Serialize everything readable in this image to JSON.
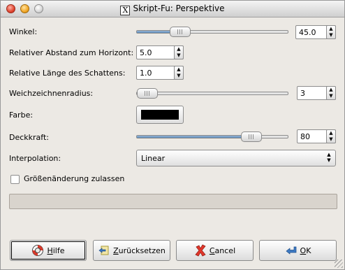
{
  "window": {
    "title": "Skript-Fu: Perspektive",
    "x_icon_glyph": "X"
  },
  "fields": {
    "angle": {
      "label": "Winkel:",
      "value": "45.0",
      "slider_fraction": 0.25
    },
    "horizon_distance": {
      "label": "Relativer Abstand zum Horizont:",
      "value": "5.0"
    },
    "shadow_length": {
      "label": "Relative Länge des Schattens:",
      "value": "1.0"
    },
    "blur_radius": {
      "label": "Weichzeichnenradius:",
      "value": "3",
      "slider_fraction": 0.0
    },
    "color": {
      "label": "Farbe:",
      "swatch": "#000000"
    },
    "opacity": {
      "label": "Deckkraft:",
      "value": "80",
      "slider_fraction": 0.8
    },
    "interpolation": {
      "label": "Interpolation:",
      "value": "Linear"
    },
    "resize": {
      "label": "Größenänderung zulassen",
      "checked": false
    }
  },
  "buttons": {
    "help": {
      "mnemonic": "H",
      "rest": "ilfe"
    },
    "reset": {
      "label": "Zurücksetzen",
      "mnemonic": "Z",
      "rest": "urücksetzen"
    },
    "cancel": {
      "mnemonic": "C",
      "rest": "ancel"
    },
    "ok": {
      "mnemonic": "O",
      "rest": "K"
    }
  },
  "colors": {
    "slider_fill": "#5a88b6",
    "window_bg": "#ece9e4"
  },
  "icons": {
    "help": "lifebuoy-icon",
    "reset": "reset-icon",
    "cancel": "cancel-x-icon",
    "ok": "ok-arrow-icon"
  }
}
